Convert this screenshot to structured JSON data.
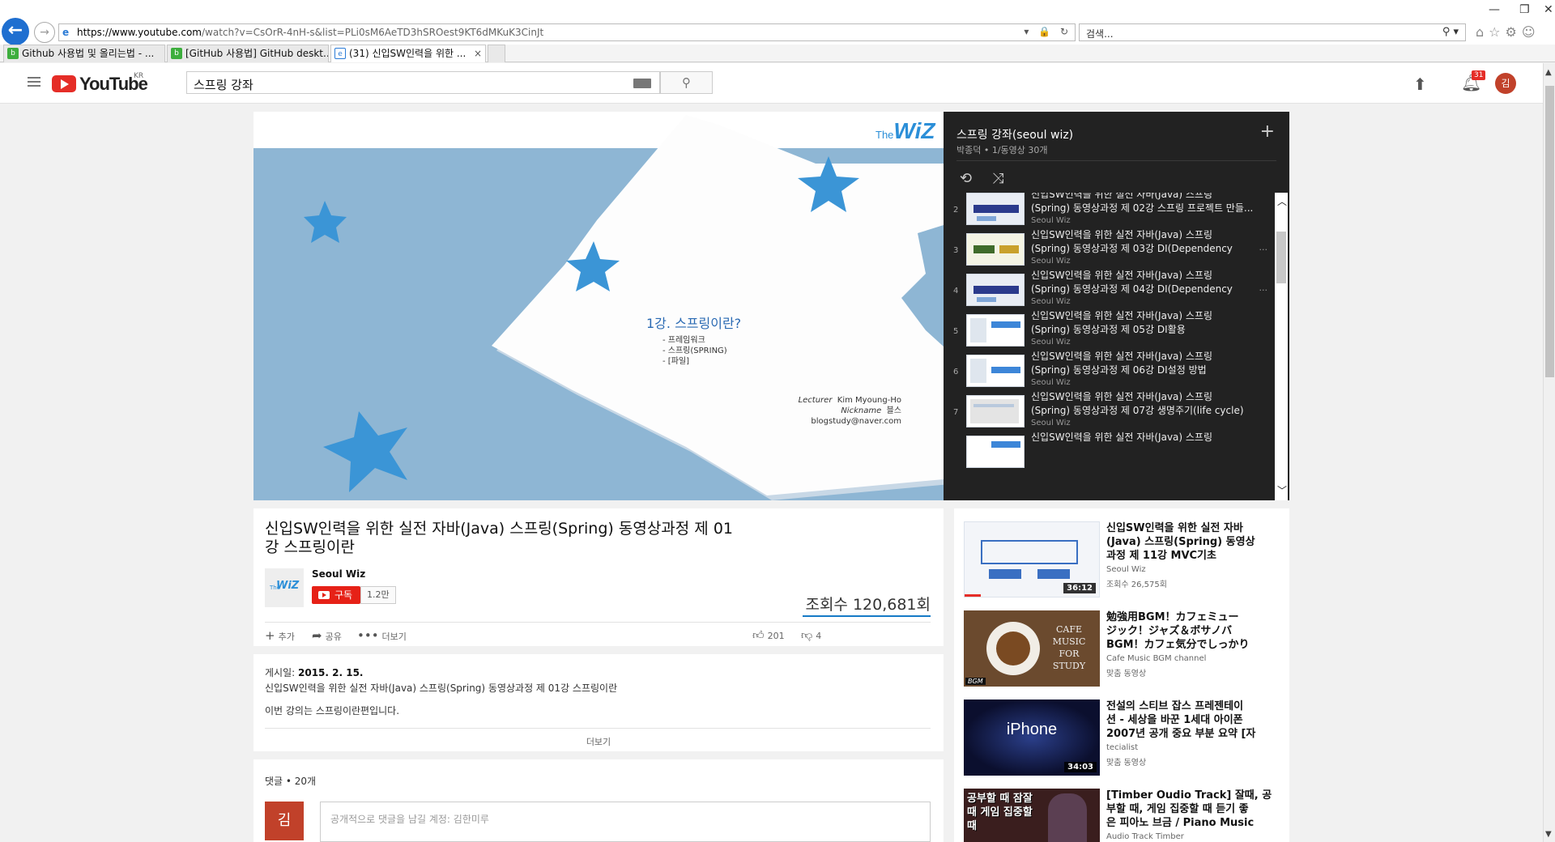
{
  "browser": {
    "url_host": "https://www.youtube.com",
    "url_rest": "/watch?v=CsOrR-4nH-s&list=PLi0sM6AeTD3hSROest9KT6dMKuK3CinJt",
    "search_placeholder": "검색...",
    "tabs": [
      {
        "label": "Github 사용법 및 올리는법 - ...",
        "favicon_color": "#3dae3d"
      },
      {
        "label": "[GitHub 사용법] GitHub deskt...",
        "favicon_color": "#3dae3d"
      },
      {
        "label": "(31) 신입SW인력을 위한 ...",
        "favicon_color": "#2a7bd6",
        "active": true
      }
    ]
  },
  "youtube": {
    "logo_text": "YouTube",
    "logo_region": "KR",
    "search_query": "스프링 강좌",
    "notification_count": "31",
    "avatar_letter": "김"
  },
  "slide": {
    "logo_the": "The",
    "logo_wiz": "WiZ",
    "title": "1강. 스프링이란?",
    "bullets": [
      "-  프레임워크",
      "-  스프링(SPRING)",
      "-  [파일]"
    ],
    "lecturer_label": "Lecturer",
    "lecturer_name": "Kim Myoung-Ho",
    "nickname_label": "Nickname",
    "nickname": "블스",
    "email": "blogstudy@naver.com"
  },
  "playlist": {
    "title": "스프링 강좌(seoul wiz)",
    "subtitle": "박종덕 • 1/동영상 30개",
    "items": [
      {
        "index": "2",
        "line1": "신입SW인력을 위한 실전 자바(Java) 스프링",
        "line2": "(Spring) 동영상과정 제 02강 스프링 프로젝트 만들...",
        "channel": "Seoul Wiz"
      },
      {
        "index": "3",
        "line1": "신입SW인력을 위한 실전 자바(Java) 스프링",
        "line2": "(Spring) 동영상과정 제 03강 DI(Dependency",
        "channel": "Seoul Wiz",
        "more": "..."
      },
      {
        "index": "4",
        "line1": "신입SW인력을 위한 실전 자바(Java) 스프링",
        "line2": "(Spring) 동영상과정 제 04강 DI(Dependency",
        "channel": "Seoul Wiz",
        "more": "..."
      },
      {
        "index": "5",
        "line1": "신입SW인력을 위한 실전 자바(Java) 스프링",
        "line2": "(Spring) 동영상과정 제 05강 DI활용",
        "channel": "Seoul Wiz"
      },
      {
        "index": "6",
        "line1": "신입SW인력을 위한 실전 자바(Java) 스프링",
        "line2": "(Spring) 동영상과정 제 06강 DI설정 방법",
        "channel": "Seoul Wiz"
      },
      {
        "index": "7",
        "line1": "신입SW인력을 위한 실전 자바(Java) 스프링",
        "line2": "(Spring) 동영상과정 제 07강 생명주기(life cycle)",
        "channel": "Seoul Wiz"
      },
      {
        "index": "",
        "line1": "신입SW인력을 위한 실전 자바(Java) 스프링",
        "line2": "",
        "channel": ""
      }
    ]
  },
  "video": {
    "title_line1": "신입SW인력을 위한 실전 자바(Java) 스프링(Spring) 동영상과정 제 01",
    "title_line2": "강 스프링이란",
    "channel_name": "Seoul Wiz",
    "channel_logo_the": "The",
    "channel_logo_wiz": "WiZ",
    "subscribe_label": "구독",
    "subscriber_count": "1.2만",
    "views": "조회수 120,681회",
    "actions": {
      "add": "추가",
      "share": "공유",
      "more": "더보기"
    },
    "likes": "201",
    "dislikes": "4"
  },
  "description": {
    "published_label": "게시일:",
    "published_date": "2015. 2. 15.",
    "line1": "신입SW인력을 위한 실전 자바(Java) 스프링(Spring) 동영상과정 제 01강 스프링이란",
    "line2": "이번 강의는 스프링이란편입니다.",
    "show_more": "더보기"
  },
  "comments": {
    "count_label": "댓글 • 20개",
    "avatar_letter": "김",
    "placeholder": "공개적으로 댓글을 남길 계정: 김한미루"
  },
  "related": [
    {
      "title_lines": [
        "신입SW인력을 위한 실전 자바",
        "(Java) 스프링(Spring) 동영상",
        "과정 제 11강 MVC기초"
      ],
      "channel": "Seoul Wiz",
      "meta": "조회수 26,575회",
      "duration": "36:12"
    },
    {
      "title_lines": [
        "勉強用BGM！カフェミュー",
        "ジック！ジャズ＆ボサノバ",
        "BGM！カフェ気分でしっかり"
      ],
      "channel": "Cafe Music BGM channel",
      "meta": "맞춤 동영상",
      "duration": "",
      "thumb_text": "CAFE MUSIC FOR STUDY",
      "thumb_badge": "BGM"
    },
    {
      "title_lines": [
        "전설의 스티브 잡스 프레젠테이",
        "션 - 세상을 바꾼 1세대 아이폰",
        "2007년 공개 중요 부분 요약 [자"
      ],
      "channel": "tecialist",
      "meta": "맞춤 동영상",
      "duration": "34:03",
      "thumb_text": "iPhone"
    },
    {
      "title_lines": [
        "[Timber Oudio Track] 잘때, 공",
        "부할 때, 게임 집중할 때 듣기 좋",
        "은 피아노 브금 / Piano Music"
      ],
      "channel": "Audio Track Timber",
      "meta": "",
      "duration": "",
      "thumb_text": "공부할 때 잠잘 때 게임 집중할 때"
    }
  ]
}
